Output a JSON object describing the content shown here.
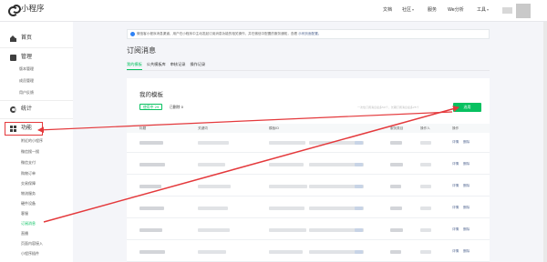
{
  "topbar": {
    "logo_text": "小程序",
    "nav": [
      "文档",
      "社区",
      "服务",
      "We分析",
      "工具"
    ]
  },
  "sidebar": {
    "home": "首页",
    "manage": "管理",
    "manage_items": [
      "版本管理",
      "成员管理",
      "用户反馈"
    ],
    "stats": "统计",
    "func": "功能",
    "func_items": [
      "附近的小程序",
      "微信搜一搜",
      "微信支付",
      "购物订单",
      "交易保障",
      "物流服务",
      "硬件设备",
      "客服",
      "订阅消息",
      "直播",
      "页面内容接入",
      "小程序插件"
    ],
    "active_item": "订阅消息"
  },
  "notice": {
    "text": "微信客小程序消息渠道，用户在小程序中主动发起订阅消息功能的相关操作，并在微信中配置的服务通知，查看",
    "link": "示例页面配置。"
  },
  "page": {
    "title": "订阅消息",
    "tabs": [
      "我的模板",
      "公共模板库",
      "审核记录",
      "操作记录"
    ],
    "active_tab": "我的模板"
  },
  "panel": {
    "title": "我的模板",
    "used_label": "使用中 29",
    "disabled_label": "已删除 0",
    "hint": "一次性订阅消息最多50个，长期订阅消息最多25个",
    "select_button": "选用",
    "columns": [
      "标题",
      "关键词",
      "模板ID",
      "服务类目",
      "操作人",
      "操作"
    ],
    "row_actions": [
      "详情",
      "删除"
    ],
    "row_count": 6
  },
  "colors": {
    "accent": "#07c160",
    "link": "#576b95",
    "annotation": "#e4393c"
  }
}
